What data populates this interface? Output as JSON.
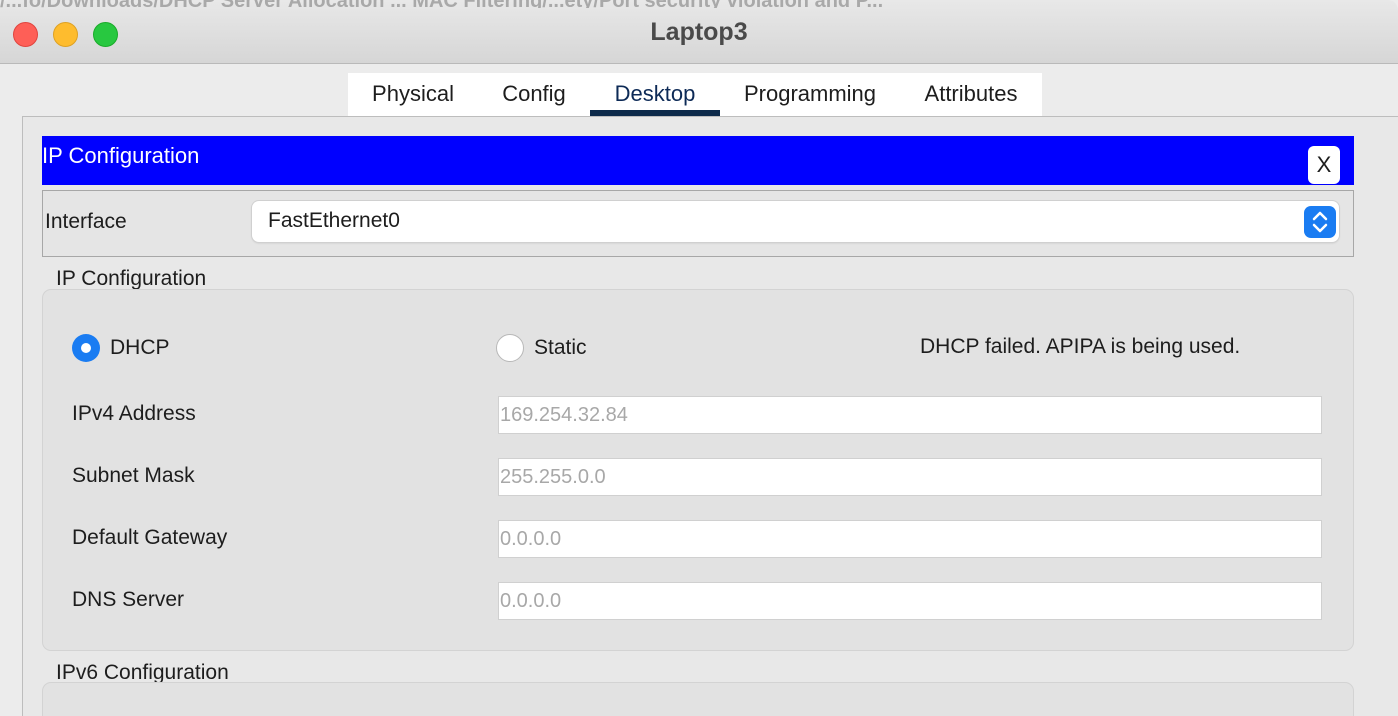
{
  "window": {
    "title": "Laptop3"
  },
  "background_text": "/...fo/Downloads/DHCP Server Allocation ... MAC Filtering/...ety/Port security violation and P...",
  "tabs": [
    {
      "label": "Physical"
    },
    {
      "label": "Config"
    },
    {
      "label": "Desktop"
    },
    {
      "label": "Programming"
    },
    {
      "label": "Attributes"
    }
  ],
  "active_tab": "Desktop",
  "header": {
    "title": "IP Configuration",
    "close_label": "X",
    "color": "#0000ff"
  },
  "interface": {
    "label": "Interface",
    "value": "FastEthernet0"
  },
  "ipv4": {
    "section_title": "IP Configuration",
    "mode_dhcp": "DHCP",
    "mode_static": "Static",
    "selected_mode": "DHCP",
    "status": "DHCP failed. APIPA is being used.",
    "fields": [
      {
        "label": "IPv4 Address",
        "value": "169.254.32.84"
      },
      {
        "label": "Subnet Mask",
        "value": "255.255.0.0"
      },
      {
        "label": "Default Gateway",
        "value": "0.0.0.0"
      },
      {
        "label": "DNS Server",
        "value": "0.0.0.0"
      }
    ]
  },
  "ipv6": {
    "section_title": "IPv6 Configuration"
  },
  "colors": {
    "accent": "#1a7cf2",
    "active_tab_underline": "#0d2a4a"
  }
}
